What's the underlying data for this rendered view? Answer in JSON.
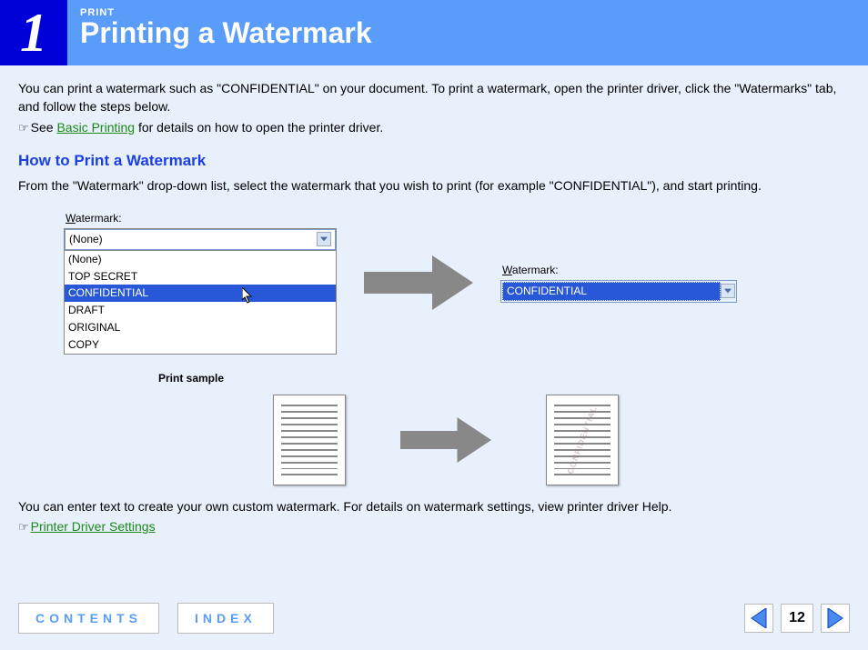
{
  "header": {
    "chapter_number": "1",
    "section_label": "PRINT",
    "title": "Printing a Watermark"
  },
  "intro": "You can print a watermark such as \"CONFIDENTIAL\" on your document. To print a watermark, open the printer driver, click the \"Watermarks\" tab, and follow the steps below.",
  "see_prefix": "See ",
  "see_link": "Basic Printing",
  "see_suffix": " for details on how to open the printer driver.",
  "subhead": "How to Print a Watermark",
  "subdesc": "From the \"Watermark\" drop-down list, select the watermark that you wish to print (for example \"CONFIDENTIAL\"), and start printing.",
  "dropdown": {
    "label_accel": "W",
    "label_rest": "atermark:",
    "selected": "(None)",
    "options": [
      "(None)",
      "TOP SECRET",
      "CONFIDENTIAL",
      "DRAFT",
      "ORIGINAL",
      "COPY"
    ],
    "highlighted": "CONFIDENTIAL"
  },
  "closed_dropdown": {
    "label_accel": "W",
    "label_rest": "atermark:",
    "selected": "CONFIDENTIAL"
  },
  "sample_label": "Print sample",
  "watermark_text": "CONFIDENTIAL",
  "footer_text": "You can enter text to create your own custom watermark. For details on watermark settings, view printer driver Help.",
  "footer_link": "Printer Driver Settings",
  "nav": {
    "contents": "CONTENTS",
    "index": "INDEX",
    "page": "12"
  }
}
